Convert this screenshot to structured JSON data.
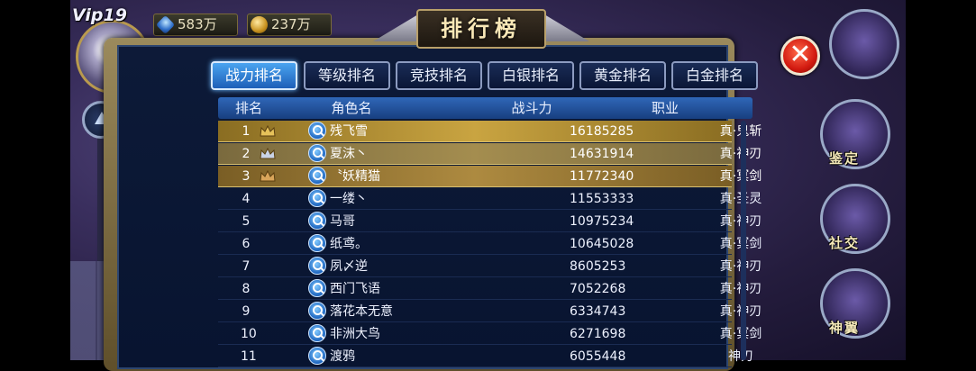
{
  "hud": {
    "vip": "Vip19",
    "gems": "583万",
    "gold": "237万"
  },
  "panel": {
    "title": "排行榜",
    "close": "✕"
  },
  "tabs": [
    "战力排名",
    "等级排名",
    "竞技排名",
    "白银排名",
    "黄金排名",
    "白金排名"
  ],
  "active_tab": 0,
  "table": {
    "headers": [
      "排名",
      "角色名",
      "战斗力",
      "职业"
    ],
    "rows": [
      {
        "rank": "1",
        "name": "残飞雪",
        "power": "16185285",
        "job": "真·鬼斩"
      },
      {
        "rank": "2",
        "name": "夏沫丶",
        "power": "14631914",
        "job": "真·神刃"
      },
      {
        "rank": "3",
        "name": "〝妖精猫",
        "power": "11772340",
        "job": "真·冥剑"
      },
      {
        "rank": "4",
        "name": "一缕丶",
        "power": "11553333",
        "job": "真·圣灵"
      },
      {
        "rank": "5",
        "name": "马哥",
        "power": "10975234",
        "job": "真·神刃"
      },
      {
        "rank": "6",
        "name": "纸鸢。",
        "power": "10645028",
        "job": "真·冥剑"
      },
      {
        "rank": "7",
        "name": "夙〆逆",
        "power": "8605253",
        "job": "真·神刃"
      },
      {
        "rank": "8",
        "name": "西门飞语",
        "power": "7052268",
        "job": "真·神刃"
      },
      {
        "rank": "9",
        "name": "落花本无意",
        "power": "6334743",
        "job": "真·神刃"
      },
      {
        "rank": "10",
        "name": "非洲大鸟",
        "power": "6271698",
        "job": "真·冥剑"
      },
      {
        "rank": "11",
        "name": "渡鸦",
        "power": "6055448",
        "job": "神刃"
      }
    ]
  },
  "right_menu": [
    "鉴定",
    "社交",
    "神翼"
  ],
  "colors": {
    "accent_tab": "#2f86df",
    "gold_row": "#c9a441",
    "panel_bg": "#0b1733"
  }
}
